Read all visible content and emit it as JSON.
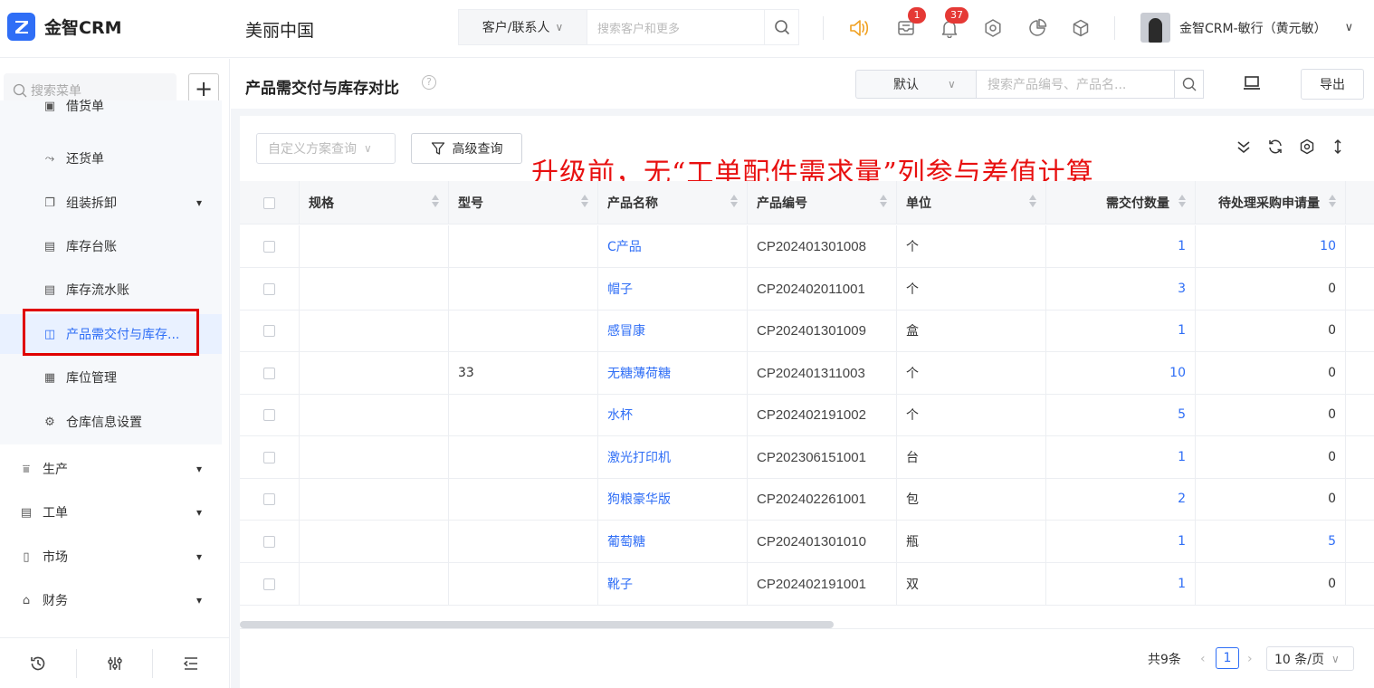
{
  "app": {
    "name": "金智CRM",
    "company": "美丽中国"
  },
  "global_search": {
    "type": "客户/联系人",
    "placeholder": "搜索客户和更多"
  },
  "notifications": {
    "inbox_count": "1",
    "bell_count": "37"
  },
  "user": {
    "name": "金智CRM-敏行（黄元敏）"
  },
  "sidebar": {
    "search_placeholder": "搜索菜单",
    "sub_items": [
      {
        "label": "借货单",
        "icon": "borrow-icon"
      },
      {
        "label": "还货单",
        "icon": "return-icon"
      },
      {
        "label": "组装拆卸",
        "icon": "assembly-icon"
      },
      {
        "label": "库存台账",
        "icon": "ledger-icon"
      },
      {
        "label": "库存流水账",
        "icon": "ledger-icon"
      },
      {
        "label": "产品需交付与库存...",
        "icon": "compare-icon",
        "active": true
      },
      {
        "label": "库位管理",
        "icon": "location-icon"
      },
      {
        "label": "仓库信息设置",
        "icon": "gear-icon"
      }
    ],
    "top_items": [
      {
        "label": "生产",
        "icon": "production-icon"
      },
      {
        "label": "工单",
        "icon": "workorder-icon"
      },
      {
        "label": "市场",
        "icon": "market-icon"
      },
      {
        "label": "财务",
        "icon": "finance-icon"
      }
    ]
  },
  "page": {
    "title": "产品需交付与库存对比",
    "plan_select": "默认",
    "search_placeholder": "搜索产品编号、产品名...",
    "export_label": "导出",
    "custom_query_placeholder": "自定义方案查询",
    "advanced_query_label": "高级查询",
    "annotation": "升级前，无“工单配件需求量”列参与差值计算"
  },
  "table": {
    "columns": [
      "规格",
      "型号",
      "产品名称",
      "产品编号",
      "单位",
      "需交付数量",
      "待处理采购申请量"
    ],
    "rows": [
      {
        "spec": "",
        "model": "",
        "name": "C产品",
        "code": "CP202401301008",
        "unit": "个",
        "deliver": "1",
        "pending": "10"
      },
      {
        "spec": "",
        "model": "",
        "name": "帽子",
        "code": "CP202402011001",
        "unit": "个",
        "deliver": "3",
        "pending": "0"
      },
      {
        "spec": "",
        "model": "",
        "name": "感冒康",
        "code": "CP202401301009",
        "unit": "盒",
        "deliver": "1",
        "pending": "0"
      },
      {
        "spec": "",
        "model": "33",
        "name": "无糖薄荷糖",
        "code": "CP202401311003",
        "unit": "个",
        "deliver": "10",
        "pending": "0"
      },
      {
        "spec": "",
        "model": "",
        "name": "水杯",
        "code": "CP202402191002",
        "unit": "个",
        "deliver": "5",
        "pending": "0"
      },
      {
        "spec": "",
        "model": "",
        "name": "激光打印机",
        "code": "CP202306151001",
        "unit": "台",
        "deliver": "1",
        "pending": "0"
      },
      {
        "spec": "",
        "model": "",
        "name": "狗粮豪华版",
        "code": "CP202402261001",
        "unit": "包",
        "deliver": "2",
        "pending": "0"
      },
      {
        "spec": "",
        "model": "",
        "name": "葡萄糖",
        "code": "CP202401301010",
        "unit": "瓶",
        "deliver": "1",
        "pending": "5"
      },
      {
        "spec": "",
        "model": "",
        "name": "靴子",
        "code": "CP202402191001",
        "unit": "双",
        "deliver": "1",
        "pending": "0"
      }
    ]
  },
  "pagination": {
    "total": "共9条",
    "current": "1",
    "page_size": "10 条/页"
  },
  "colors": {
    "primary": "#2f6ef6",
    "badge": "#e53935",
    "annotation": "#e81010",
    "speaker": "#f0a020"
  }
}
